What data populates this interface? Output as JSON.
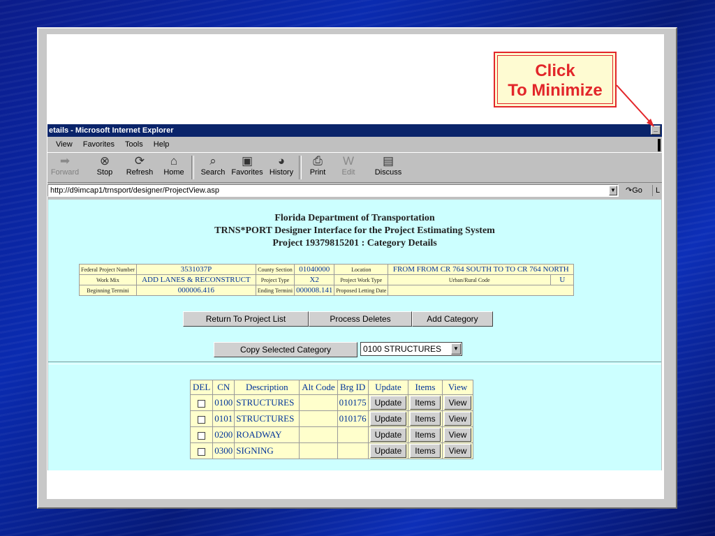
{
  "callout": {
    "line1": "Click",
    "line2": "To Minimize"
  },
  "window": {
    "title": "etails - Microsoft Internet Explorer"
  },
  "menu": [
    "View",
    "Favorites",
    "Tools",
    "Help"
  ],
  "toolbar": {
    "forward": "Forward",
    "stop": "Stop",
    "refresh": "Refresh",
    "home": "Home",
    "search": "Search",
    "favorites": "Favorites",
    "history": "History",
    "print": "Print",
    "edit": "Edit",
    "discuss": "Discuss"
  },
  "address": {
    "url": "http://d9imcap1/trnsport/designer/ProjectView.asp",
    "go": "Go",
    "links": "L"
  },
  "header": {
    "line1": "Florida Department of Transportation",
    "line2": "TRNS*PORT Designer Interface for the Project Estimating System",
    "line3": "Project 19379815201 : Category Details"
  },
  "info": {
    "federal_project_number_label": "Federal Project Number",
    "federal_project_number": "3531037P",
    "county_section_label": "County Section",
    "county_section": "01040000",
    "location_label": "Location",
    "location": "FROM FROM CR 764 SOUTH TO TO CR 764 NORTH",
    "work_mix_label": "Work Mix",
    "work_mix": "ADD LANES & RECONSTRUCT",
    "project_type_label": "Project Type",
    "project_type": "X2",
    "project_work_type_label": "Project Work Type",
    "project_work_type": "",
    "urban_rural_label": "Urban/Rural Code",
    "urban_rural": "U",
    "beginning_termini_label": "Beginning Termini",
    "beginning_termini": "000006.416",
    "ending_termini_label": "Ending Termini",
    "ending_termini": "000008.141",
    "proposed_letting_label": "Proposed Letting Date",
    "proposed_letting": ""
  },
  "actions": {
    "return": "Return To Project List",
    "process_deletes": "Process Deletes",
    "add_category": "Add Category",
    "copy_selected": "Copy Selected Category",
    "category_select": "0100 STRUCTURES"
  },
  "table": {
    "headers": [
      "DEL",
      "CN",
      "Description",
      "Alt Code",
      "Brg ID",
      "Update",
      "Items",
      "View"
    ],
    "rows": [
      {
        "cn": "0100",
        "description": "STRUCTURES",
        "alt": "",
        "brg": "010175",
        "update": "Update",
        "items": "Items",
        "view": "View"
      },
      {
        "cn": "0101",
        "description": "STRUCTURES",
        "alt": "",
        "brg": "010176",
        "update": "Update",
        "items": "Items",
        "view": "View"
      },
      {
        "cn": "0200",
        "description": "ROADWAY",
        "alt": "",
        "brg": "",
        "update": "Update",
        "items": "Items",
        "view": "View"
      },
      {
        "cn": "0300",
        "description": "SIGNING",
        "alt": "",
        "brg": "",
        "update": "Update",
        "items": "Items",
        "view": "View"
      }
    ]
  }
}
